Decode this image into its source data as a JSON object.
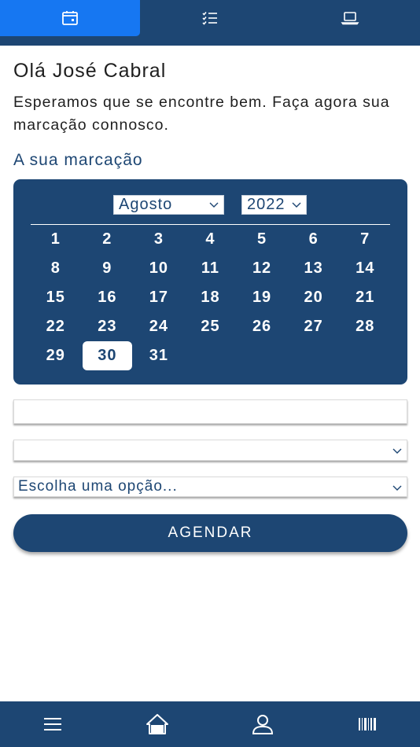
{
  "top_tabs": [
    {
      "icon": "calendar-icon",
      "active": true
    },
    {
      "icon": "checklist-icon",
      "active": false
    },
    {
      "icon": "laptop-icon",
      "active": false
    }
  ],
  "greeting": "Olá José Cabral",
  "intro": "Esperamos que se encontre bem. Faça agora sua marcação connosco.",
  "section_title": "A sua marcação",
  "calendar": {
    "month": "Agosto",
    "year": "2022",
    "days": [
      "1",
      "2",
      "3",
      "4",
      "5",
      "6",
      "7",
      "8",
      "9",
      "10",
      "11",
      "12",
      "13",
      "14",
      "15",
      "16",
      "17",
      "18",
      "19",
      "20",
      "21",
      "22",
      "23",
      "24",
      "25",
      "26",
      "27",
      "28",
      "29",
      "30",
      "31"
    ],
    "selected_day": "30"
  },
  "form": {
    "text_value": "",
    "select1_value": "",
    "select2_value": "Escolha uma opção...",
    "submit_label": "AGENDAR"
  },
  "bottom_nav": [
    "menu-icon",
    "home-icon",
    "user-icon",
    "barcode-icon"
  ],
  "colors": {
    "primary": "#1d4673",
    "accent": "#1677f2",
    "background": "#ffffff"
  }
}
